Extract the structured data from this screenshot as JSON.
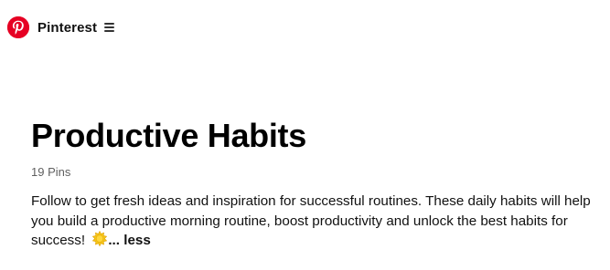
{
  "header": {
    "logo_icon": "pinterest-logo-icon",
    "brand": "Pinterest",
    "menu_icon": "hamburger-menu-icon",
    "brand_color": "#e60023"
  },
  "board": {
    "title": "Productive Habits",
    "pin_count": "19 Pins",
    "description": "Follow to get fresh ideas and inspiration for successful routines. These daily habits will help you build a productive morning routine, boost productivity and unlock the best habits for success!",
    "emoji_icon": "sun-emoji-icon",
    "ellipsis": "...",
    "less_label": "less"
  }
}
